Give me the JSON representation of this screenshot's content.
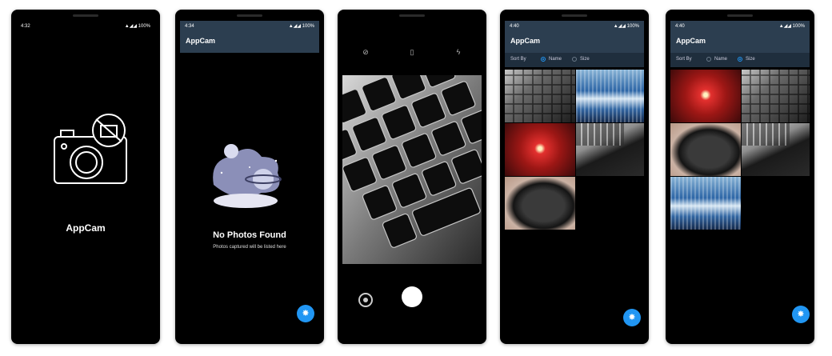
{
  "status": {
    "s1_time": "4:32",
    "s2_time": "4:34",
    "s4_time": "4:40",
    "s5_time": "4:40",
    "icons": "▲◢◢",
    "battery": "100%"
  },
  "splash": {
    "title": "AppCam"
  },
  "empty": {
    "appbar_title": "AppCam",
    "title": "No Photos Found",
    "subtitle": "Photos captured will be listed here"
  },
  "camera": {
    "flash_icon": "flash-off-icon",
    "rotate_icon": "screen-rotation-icon",
    "timer_icon": "timer-off-icon",
    "switch_icon": "switch-camera-icon"
  },
  "gallery_name": {
    "appbar_title": "AppCam",
    "sort_label": "Sort By",
    "option_name": "Name",
    "option_size": "Size",
    "selected": "Name"
  },
  "gallery_size": {
    "appbar_title": "AppCam",
    "sort_label": "Sort By",
    "option_name": "Name",
    "option_size": "Size",
    "selected": "Size"
  },
  "fab_icon": "camera-icon"
}
